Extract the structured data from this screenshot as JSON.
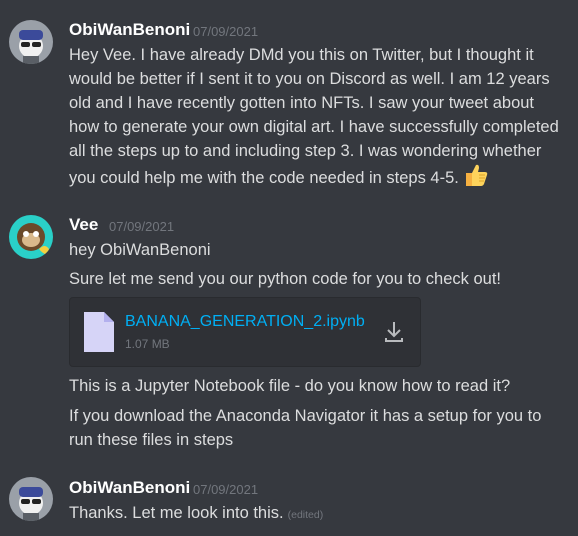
{
  "messages": [
    {
      "author": "ObiWanBenoni",
      "timestamp": "07/09/2021",
      "lines": [
        "Hey Vee. I have already DMd you this on Twitter, but I thought it",
        "would be better if I sent it to you on Discord as well. I am 12 years",
        "old and I have recently gotten into NFTs. I saw your tweet about",
        "how to generate your own digital art. I have successfully completed",
        "all the steps up to and including step 3. I was wondering whether",
        "you could help me with the code needed in steps 4-5."
      ],
      "emoji": "thumbs-up-emoji"
    },
    {
      "author": "Vee",
      "timestamp": "07/09/2021",
      "line1": "hey ObiWanBenoni",
      "line2": "Sure let me send you our python code for you to check out!",
      "attachment": {
        "filename": "BANANA_GENERATION_2.ipynb",
        "size": "1.07 MB",
        "icon": "file-icon",
        "action_icon": "download-icon"
      },
      "line3": "This is a Jupyter Notebook file - do you know how to read it?",
      "line4a": "If you download the Anaconda Navigator it has a setup for you to",
      "line4b": "run these files in steps"
    },
    {
      "author": "ObiWanBenoni",
      "timestamp": "07/09/2021",
      "text": "Thanks. Let me look into this.",
      "edited": "(edited)"
    }
  ],
  "colors": {
    "background": "#36393f",
    "link": "#00aff4",
    "muted": "#72767d",
    "text": "#dcddde"
  }
}
